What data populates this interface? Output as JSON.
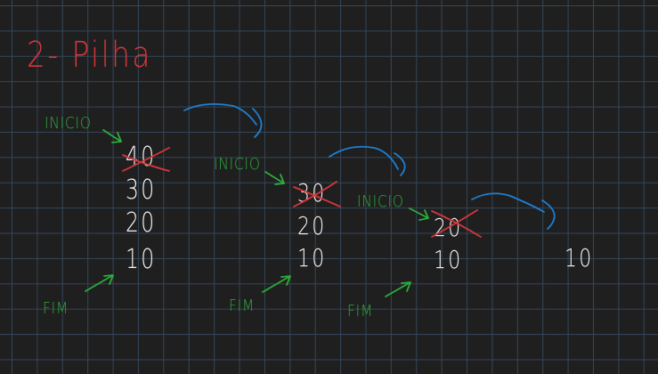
{
  "title": "2- Pilha",
  "labels": {
    "inicio": "INICIO",
    "fim": "FIM"
  },
  "stacks": [
    {
      "values": [
        "40",
        "30",
        "20",
        "10"
      ],
      "removed": "40"
    },
    {
      "values": [
        "30",
        "20",
        "10"
      ],
      "removed": "30"
    },
    {
      "values": [
        "20",
        "10"
      ],
      "removed": "20"
    },
    {
      "values": [
        "10"
      ]
    }
  ],
  "colors": {
    "background": "#1f1f1f",
    "grid": "#33465a",
    "title": "#d6363b",
    "labels": "#2cad3a",
    "numbers": "#f4f4f4",
    "strike": "#d6363b",
    "transition_arrow": "#1f7fd1"
  }
}
